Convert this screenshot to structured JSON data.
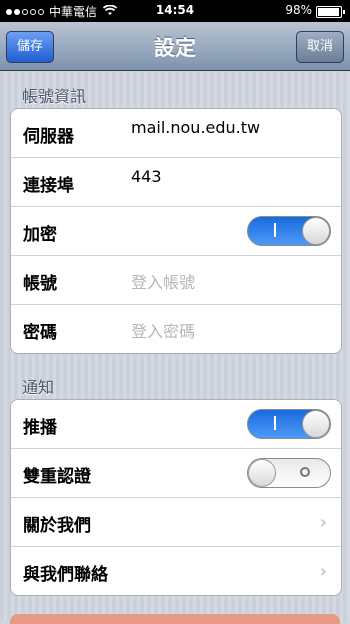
{
  "status_bar": {
    "carrier": "中華電信",
    "time": "14:54",
    "battery": "98%"
  },
  "nav": {
    "title": "設定",
    "save_label": "儲存",
    "cancel_label": "取消"
  },
  "account_section": {
    "header": "帳號資訊",
    "server_label": "伺服器",
    "server_value": "mail.nou.edu.tw",
    "port_label": "連接埠",
    "port_value": "443",
    "encrypt_label": "加密",
    "encrypt_on": true,
    "account_label": "帳號",
    "account_placeholder": "登入帳號",
    "password_label": "密碼",
    "password_placeholder": "登入密碼"
  },
  "notify_section": {
    "header": "通知",
    "push_label": "推播",
    "push_on": true,
    "twofa_label": "雙重認證",
    "twofa_on": false,
    "about_label": "關於我們",
    "contact_label": "與我們聯絡"
  },
  "colors": {
    "accent": "#1f5fd0",
    "toggle_on": "#1a6ae0"
  }
}
